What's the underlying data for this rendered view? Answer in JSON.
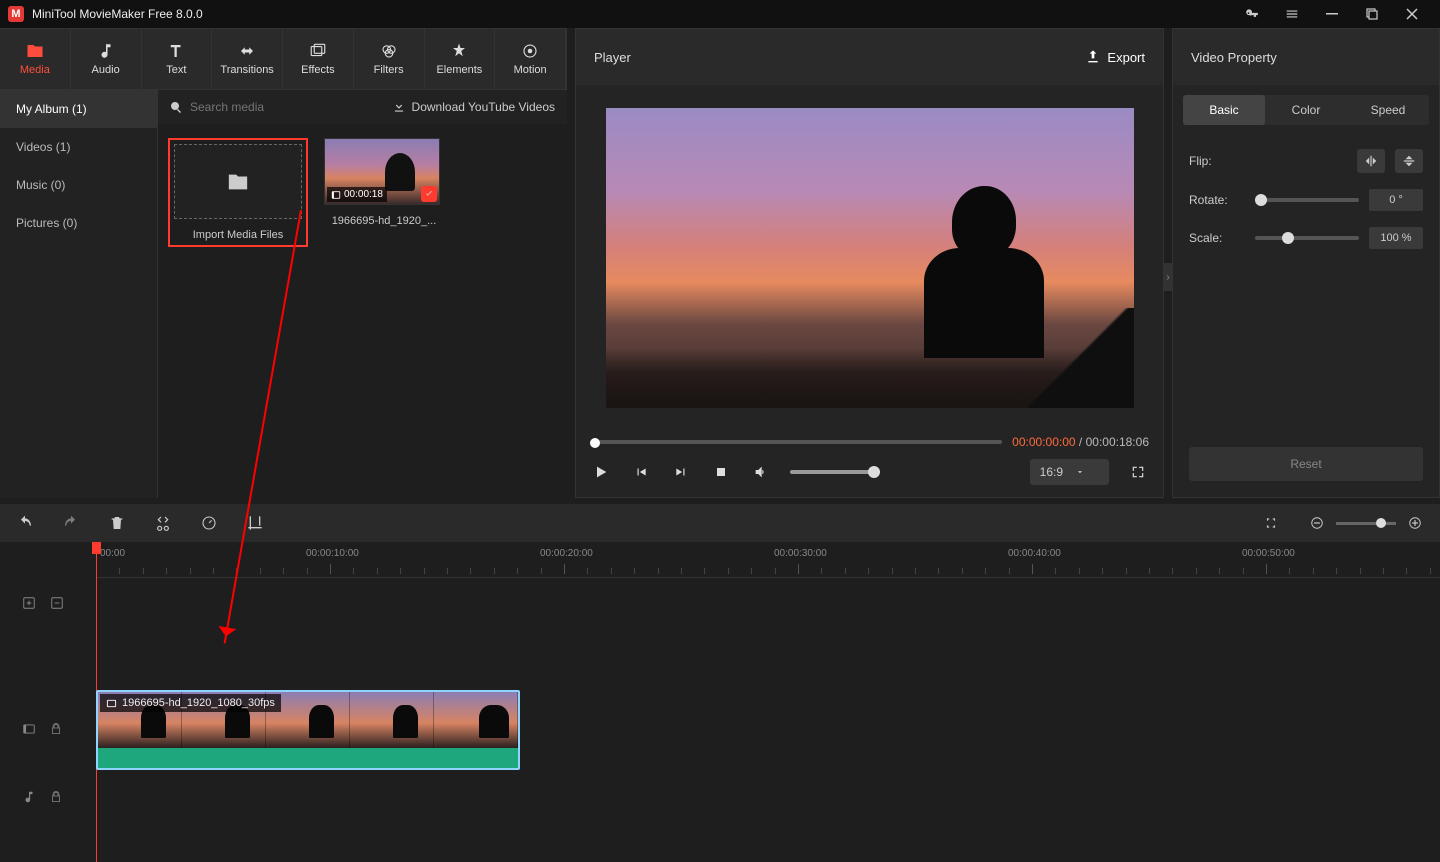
{
  "title": "MiniTool MovieMaker Free 8.0.0",
  "topTabs": [
    {
      "label": "Media",
      "active": true
    },
    {
      "label": "Audio"
    },
    {
      "label": "Text"
    },
    {
      "label": "Transitions"
    },
    {
      "label": "Effects"
    },
    {
      "label": "Filters"
    },
    {
      "label": "Elements"
    },
    {
      "label": "Motion"
    }
  ],
  "sidebar": [
    {
      "label": "My Album (1)",
      "active": true
    },
    {
      "label": "Videos (1)"
    },
    {
      "label": "Music (0)"
    },
    {
      "label": "Pictures (0)"
    }
  ],
  "search": {
    "placeholder": "Search media"
  },
  "downloadLink": "Download YouTube Videos",
  "importLabel": "Import Media Files",
  "clip": {
    "duration": "00:00:18",
    "name": "1966695-hd_1920_..."
  },
  "player": {
    "title": "Player",
    "exportLabel": "Export",
    "currentTime": "00:00:00:00",
    "totalTime": "00:00:18:06",
    "aspect": "16:9"
  },
  "property": {
    "title": "Video Property",
    "tabs": [
      "Basic",
      "Color",
      "Speed"
    ],
    "flipLabel": "Flip:",
    "rotateLabel": "Rotate:",
    "rotateValue": "0 °",
    "scaleLabel": "Scale:",
    "scaleValue": "100 %",
    "resetLabel": "Reset"
  },
  "timeline": {
    "ticks": [
      "00:00",
      "00:00:10:00",
      "00:00:20:00",
      "00:00:30:00",
      "00:00:40:00",
      "00:00:50:00"
    ],
    "clipName": "1966695-hd_1920_1080_30fps"
  }
}
